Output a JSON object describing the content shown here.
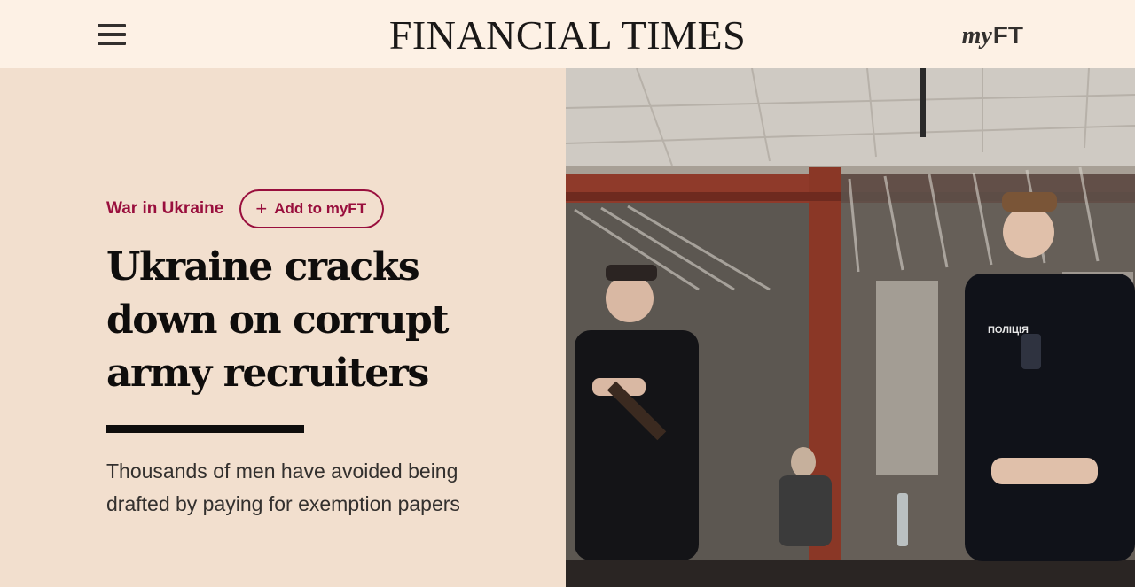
{
  "header": {
    "menu_icon": "hamburger-menu-icon",
    "logo": "FINANCIAL TIMES",
    "myft_prefix": "my",
    "myft_suffix": "FT"
  },
  "article": {
    "topic": "War in Ukraine",
    "follow_button": "Add to myFT",
    "follow_icon": "plus-icon",
    "headline": {
      "line1": "Ukraine cracks",
      "line2": "down on corrupt",
      "line3": "army recruiters"
    },
    "standfirst": {
      "line1": "Thousands of men have avoided being",
      "line2": "drafted by paying for exemption papers"
    }
  },
  "image": {
    "uniform_badge": "ПОЛІЦІЯ"
  },
  "colors": {
    "page_background": "#f2dfce",
    "header_background": "#fdf1e5",
    "accent": "#990f3d",
    "text": "#1a1817"
  }
}
